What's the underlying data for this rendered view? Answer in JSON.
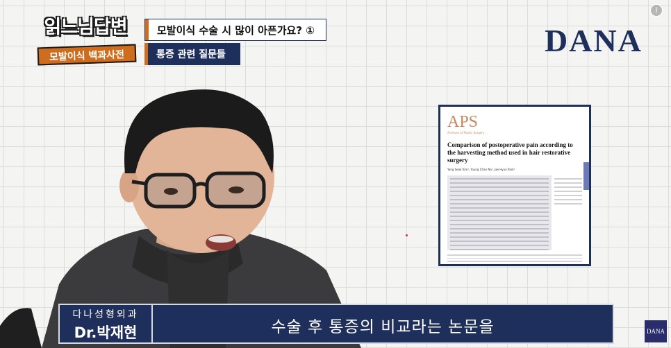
{
  "badge": {
    "title": "읽느님답변",
    "subtitle": "모발이식 백과사전"
  },
  "question": {
    "title": "모발이식 수술 시 많이 아픈가요? ①",
    "category": "통증 관련 질문들"
  },
  "logo": {
    "text": "DANA",
    "brand_color": "#1f2f5c"
  },
  "info_icon": "info-icon",
  "paper": {
    "journal": "APS",
    "journal_sub": "Archives of Plastic Surgery",
    "title": "Comparison of postoperative pain according to the harvesting method used in hair restorative surgery",
    "authors": "Yang Seok Kim¹, Young Chan Na¹, Jae Hyun Park²"
  },
  "nameplate": {
    "clinic": "다나성형외과",
    "doctor": "Dr.박재현"
  },
  "subtitle": "수술 후 통증의 비교라는 논문을",
  "thumbnail": {
    "text": "DANA"
  },
  "colors": {
    "navy": "#1f2f5c",
    "orange": "#d06b1e"
  }
}
